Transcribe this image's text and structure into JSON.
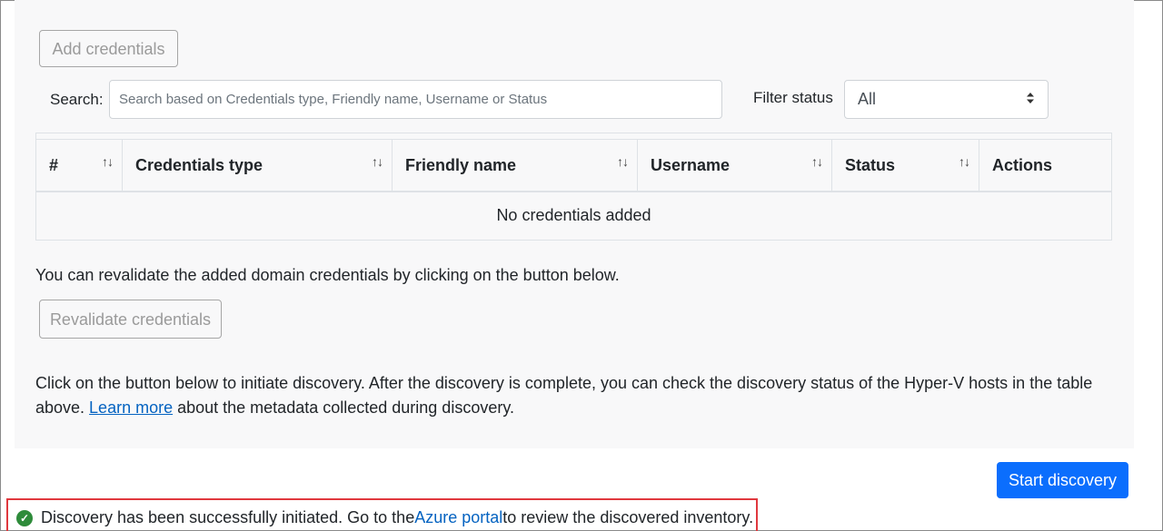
{
  "buttons": {
    "add_credentials": "Add credentials",
    "revalidate_credentials": "Revalidate credentials",
    "start_discovery": "Start discovery"
  },
  "search": {
    "label": "Search:",
    "placeholder": "Search based on Credentials type, Friendly name, Username or Status"
  },
  "filter": {
    "label": "Filter status",
    "selected": "All"
  },
  "table": {
    "columns": [
      "#",
      "Credentials type",
      "Friendly name",
      "Username",
      "Status",
      "Actions"
    ],
    "sort_icon": "↑↓",
    "empty_message": "No credentials added"
  },
  "revalidate_text": "You can revalidate the added domain credentials by clicking on the button below.",
  "discovery": {
    "text_before": "Click on the button below to initiate discovery. After the discovery is complete, you can check the discovery status of the Hyper-V hosts in the table above. ",
    "link": "Learn more",
    "text_after": " about the metadata collected during discovery."
  },
  "status": {
    "text_before": "Discovery has been successfully initiated. Go to the ",
    "link": "Azure portal",
    "text_after": " to review the discovered inventory."
  },
  "colors": {
    "primary": "#0b6efd",
    "success": "#2e8b3a",
    "highlight_border": "#e0383e",
    "link": "#0563c1"
  }
}
